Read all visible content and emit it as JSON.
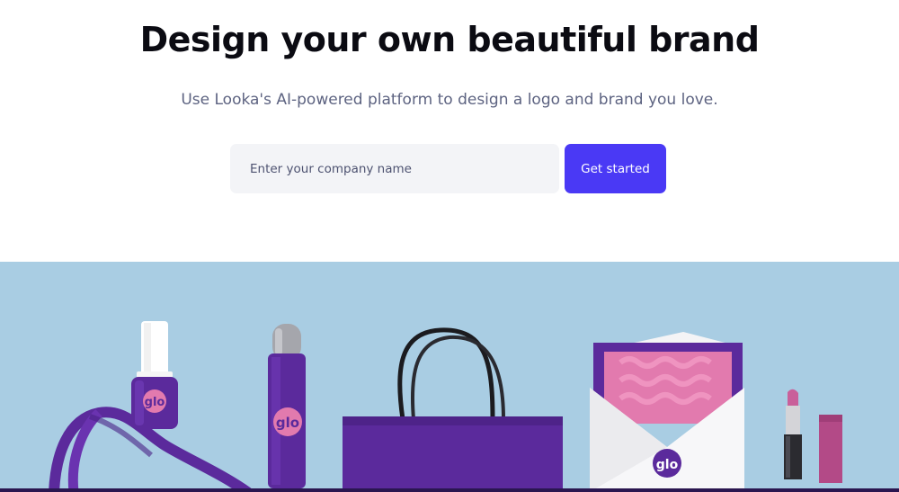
{
  "hero": {
    "headline": "Design your own beautiful brand",
    "subhead": "Use Looka's AI-powered platform to design a logo and brand you love."
  },
  "signup": {
    "input_placeholder": "Enter your company name",
    "input_value": "",
    "cta_label": "Get started"
  },
  "mockup": {
    "logo_text": "glo",
    "background_color": "#a9cde3",
    "brand_color": "#5b2a9c",
    "accent_color": "#e27aae",
    "items": [
      "ribbon",
      "nail-polish-bottle",
      "spray-can",
      "shopping-bag",
      "envelope-with-card",
      "lipstick"
    ]
  },
  "theme": {
    "accent": "#4a39f5",
    "headline_color": "#0b0b12",
    "subhead_color": "#5d6381"
  }
}
